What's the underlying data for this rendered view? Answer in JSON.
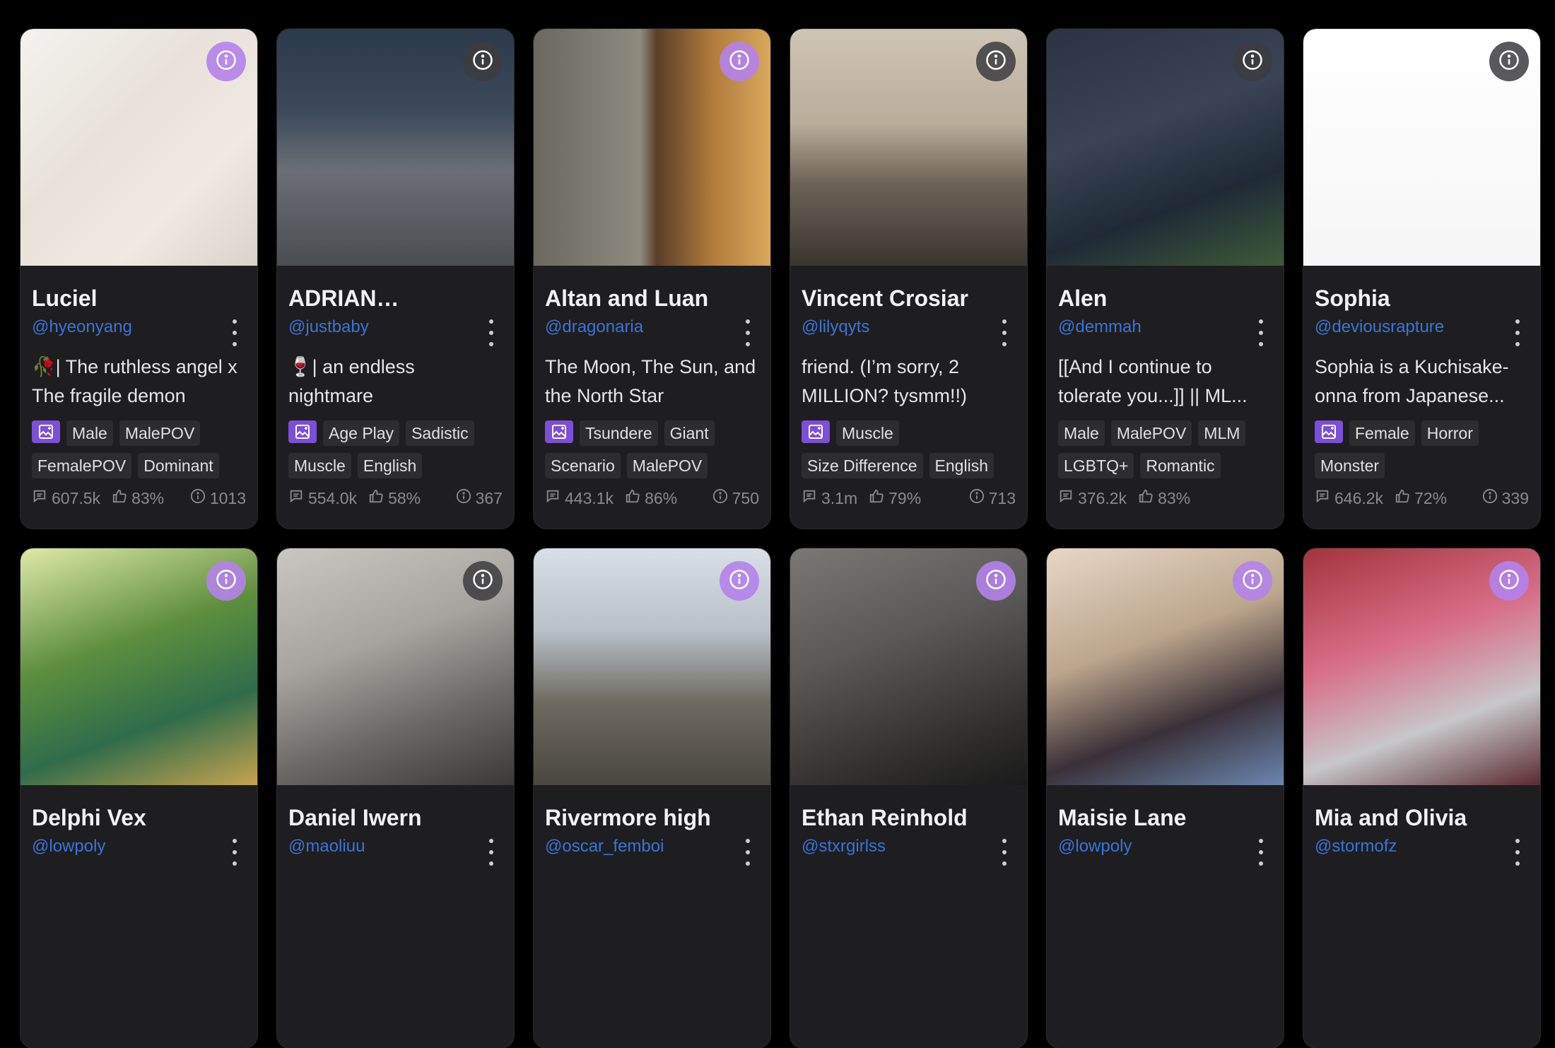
{
  "colors": {
    "background": "#000000",
    "card": "#1e1e20",
    "handle": "#3b74d6",
    "tag_bg": "#2d2d30",
    "image_tag_bg": "#7b4fd8",
    "info_purple": "#b482eb"
  },
  "cards": [
    {
      "name": "Luciel",
      "handle": "@hyeonyang",
      "description": "🥀| The ruthless angel x The fragile demon",
      "has_image_tag": true,
      "tags": [
        "Male",
        "MalePOV",
        "FemalePOV",
        "Dominant"
      ],
      "chats": "607.5k",
      "rating": "83%",
      "tokens": "1013",
      "info_style": "purple",
      "art": "pale"
    },
    {
      "name": "ADRIAN…",
      "handle": "@justbaby",
      "description": "🍷| an endless nightmare",
      "has_image_tag": true,
      "tags": [
        "Age Play",
        "Sadistic",
        "Muscle",
        "English"
      ],
      "chats": "554.0k",
      "rating": "58%",
      "tokens": "367",
      "info_style": "dark",
      "art": "suit"
    },
    {
      "name": "Altan and Luan",
      "handle": "@dragonaria",
      "description": "The Moon, The Sun, and the North Star",
      "has_image_tag": true,
      "tags": [
        "Tsundere",
        "Giant",
        "Scenario",
        "MalePOV"
      ],
      "chats": "443.1k",
      "rating": "86%",
      "tokens": "750",
      "info_style": "purple",
      "art": "gold"
    },
    {
      "name": "Vincent Crosiar",
      "handle": "@lilyqyts",
      "description": "friend. (I’m sorry, 2 MILLION? tysmm!!)",
      "has_image_tag": true,
      "tags": [
        "Muscle",
        "Size Difference",
        "English"
      ],
      "chats": "3.1m",
      "rating": "79%",
      "tokens": "713",
      "info_style": "dark",
      "art": "kitchen"
    },
    {
      "name": "Alen",
      "handle": "@demmah",
      "description": "[[And I continue to tolerate you...]] || ML...",
      "has_image_tag": false,
      "tags": [
        "Male",
        "MalePOV",
        "MLM",
        "LGBTQ+",
        "Romantic"
      ],
      "chats": "376.2k",
      "rating": "83%",
      "tokens": "",
      "info_style": "dark",
      "art": "dark"
    },
    {
      "name": "Sophia",
      "handle": "@deviousrapture",
      "description": "Sophia is a Kuchisake-onna from Japanese...",
      "has_image_tag": true,
      "tags": [
        "Female",
        "Horror",
        "Monster"
      ],
      "chats": "646.2k",
      "rating": "72%",
      "tokens": "339",
      "info_style": "dark",
      "art": "white"
    },
    {
      "name": "Delphi Vex",
      "handle": "@lowpoly",
      "info_style": "purple",
      "art": "green"
    },
    {
      "name": "Daniel Iwern",
      "handle": "@maoliuu",
      "info_style": "dark",
      "art": "sketch"
    },
    {
      "name": "Rivermore high",
      "handle": "@oscar_femboi",
      "info_style": "purple",
      "art": "castle"
    },
    {
      "name": "Ethan Reinhold",
      "handle": "@stxrgirlss",
      "info_style": "purple",
      "art": "mono"
    },
    {
      "name": "Maisie Lane",
      "handle": "@lowpoly",
      "info_style": "purple",
      "art": "room"
    },
    {
      "name": "Mia and Olivia",
      "handle": "@stormofz",
      "info_style": "purple",
      "art": "pink"
    }
  ]
}
